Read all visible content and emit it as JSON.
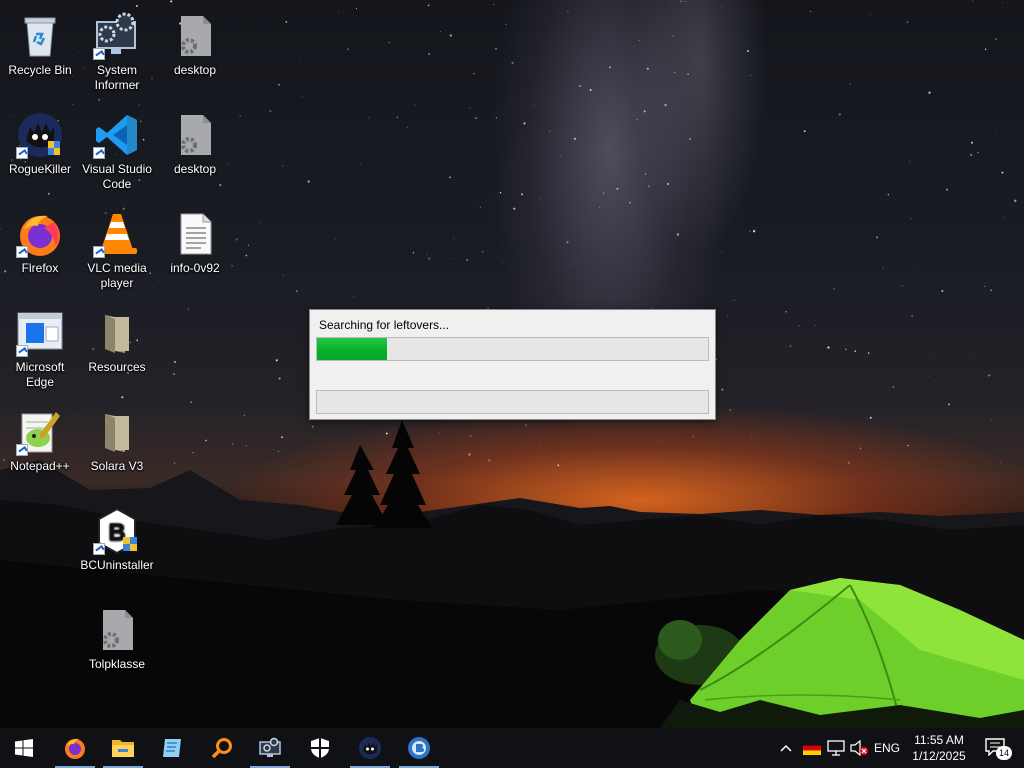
{
  "desktop": {
    "icons": [
      {
        "label": "Recycle Bin",
        "icon": "recycle-bin-icon"
      },
      {
        "label": "System Informer",
        "icon": "system-informer-icon"
      },
      {
        "label": "desktop",
        "icon": "settings-file-icon"
      },
      {
        "label": "RogueKiller",
        "icon": "roguekiller-icon"
      },
      {
        "label": "Visual Studio Code",
        "icon": "vscode-icon"
      },
      {
        "label": "desktop",
        "icon": "settings-file-icon"
      },
      {
        "label": "Firefox",
        "icon": "firefox-icon"
      },
      {
        "label": "VLC media player",
        "icon": "vlc-icon"
      },
      {
        "label": "info-0v92",
        "icon": "text-file-icon"
      },
      {
        "label": "Microsoft Edge",
        "icon": "edge-icon"
      },
      {
        "label": "Resources",
        "icon": "folder-icon"
      },
      {
        "label": "Notepad++",
        "icon": "notepadpp-icon"
      },
      {
        "label": "Solara V3",
        "icon": "folder-icon"
      },
      {
        "label": "BCUninstaller",
        "icon": "bcuninstaller-icon"
      },
      {
        "label": "Tolpklasse",
        "icon": "settings-file-icon"
      }
    ]
  },
  "dialog": {
    "status_text": "Searching for leftovers...",
    "progress_fraction": 0.18,
    "secondary_progress_fraction": 0
  },
  "taskbar": {
    "apps": [
      "start-icon",
      "firefox-icon",
      "file-explorer-icon",
      "notepad-icon",
      "search-tool-icon",
      "network-tool-icon",
      "shield-icon",
      "roguekiller-icon",
      "bcuninstaller-icon"
    ],
    "tray": {
      "language": "ENG",
      "time": "11:55 AM",
      "date": "1/12/2025",
      "notification_count": "14"
    }
  },
  "colors": {
    "progress_green": "#06b025",
    "taskbar": "#101114",
    "tent_green": "#7ed321"
  }
}
